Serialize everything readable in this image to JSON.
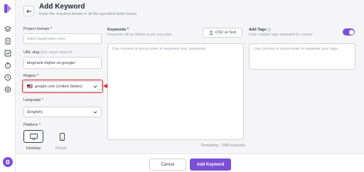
{
  "header": {
    "title": "Add Keyword",
    "subtitle": "Enter the required details in all the specified fields below"
  },
  "form": {
    "project_domain": {
      "label": "Project domain *",
      "placeholder": "https://applrodes.com/"
    },
    "url_slug": {
      "label": "URL slug",
      "hint": "(For exact search)",
      "value": "blog/rank-higher-on-google/"
    },
    "region": {
      "label": "Region *",
      "value": "google.com (United States)"
    },
    "language": {
      "label": "Language *",
      "value": "(English)"
    },
    "platform": {
      "label": "Platform *",
      "options": [
        {
          "label": "Desktop",
          "icon": "desktop-icon",
          "selected": true
        },
        {
          "label": "Mobile",
          "icon": "mobile-icon",
          "selected": false
        }
      ]
    }
  },
  "keywords": {
    "label": "Keywords *",
    "hint": "Keywords will be limited as per your plan",
    "csv_button": "CSV or Text",
    "placeholder": "Use comma or press enter to separate your keywords",
    "remaining": "Remaining : 1598 keywords"
  },
  "tags": {
    "label": "Add Tags",
    "hint": "Enter multiple tags separated by comma",
    "placeholder": "Use comma or press enter to separate your tags",
    "toggle_on": true
  },
  "footer": {
    "cancel": "Cancel",
    "submit": "Add Keyword"
  },
  "sidebar": {
    "avatar": "B"
  },
  "colors": {
    "accent": "#7b4fd6",
    "highlight": "#e02424"
  }
}
